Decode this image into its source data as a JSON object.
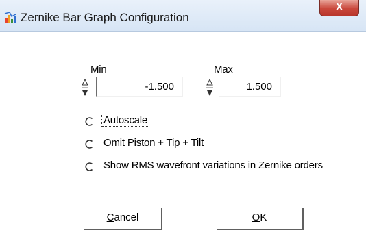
{
  "window": {
    "title": "Zernike Bar Graph Configuration",
    "close_label": "X"
  },
  "range": {
    "min_label": "Min",
    "min_value": "-1.500",
    "max_label": "Max",
    "max_value": "1.500"
  },
  "options": [
    {
      "label": "Autoscale",
      "selected": false
    },
    {
      "label": "Omit Piston + Tip + Tilt",
      "selected": false
    },
    {
      "label": "Show RMS wavefront variations in Zernike orders",
      "selected": false
    }
  ],
  "buttons": {
    "cancel_mnemonic": "C",
    "cancel_rest": "ancel",
    "ok_mnemonic": "O",
    "ok_rest": "K"
  }
}
